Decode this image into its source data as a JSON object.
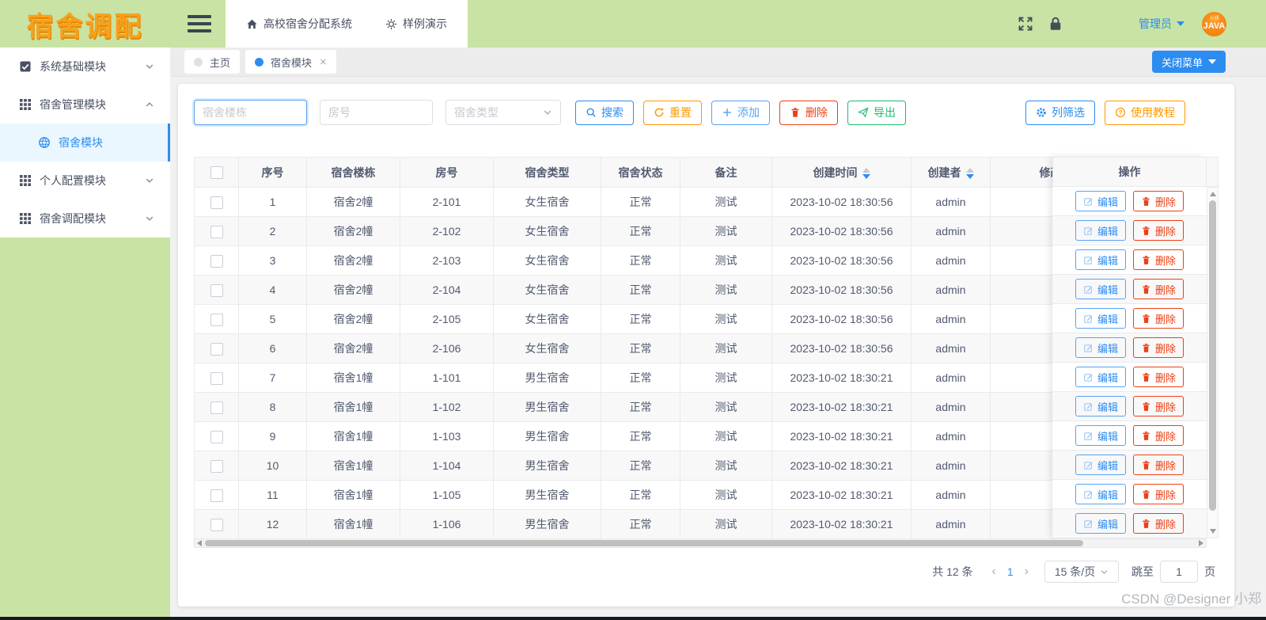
{
  "logo": "宿舍调配",
  "header": {
    "nav_system_title": "高校宿舍分配系统",
    "nav_demo": "样例演示",
    "user_name": "管理员",
    "avatar_top_text": "小郑",
    "avatar_text": "JAVA"
  },
  "sidebar": {
    "items": [
      {
        "label": "系统基础模块",
        "state": "collapsed"
      },
      {
        "label": "宿舍管理模块",
        "state": "expanded"
      },
      {
        "label": "个人配置模块",
        "state": "collapsed"
      },
      {
        "label": "宿舍调配模块",
        "state": "collapsed"
      }
    ],
    "active_subitem": "宿舍模块"
  },
  "tabs": [
    {
      "label": "主页",
      "active": false,
      "closable": false
    },
    {
      "label": "宿舍模块",
      "active": true,
      "closable": true
    }
  ],
  "tabbar": {
    "close_menu_label": "关闭菜单"
  },
  "filters": {
    "building_placeholder": "宿舍楼栋",
    "room_placeholder": "房号",
    "type_placeholder": "宿舍类型"
  },
  "toolbar": {
    "search": "搜索",
    "reset": "重置",
    "add": "添加",
    "delete": "删除",
    "export": "导出",
    "column_filter": "列筛选",
    "tutorial": "使用教程"
  },
  "table": {
    "headers": [
      "序号",
      "宿舍楼栋",
      "房号",
      "宿舍类型",
      "宿舍状态",
      "备注",
      "创建时间",
      "创建者",
      "修改时间",
      "操作"
    ],
    "sorted_columns": [
      "创建时间",
      "创建者"
    ],
    "edit_label": "编辑",
    "delete_label": "删除",
    "rows": [
      {
        "no": "1",
        "building": "宿舍2幢",
        "room": "2-101",
        "type": "女生宿舍",
        "status": "正常",
        "note": "测试",
        "created": "2023-10-02 18:30:56",
        "creator": "admin",
        "modified": ""
      },
      {
        "no": "2",
        "building": "宿舍2幢",
        "room": "2-102",
        "type": "女生宿舍",
        "status": "正常",
        "note": "测试",
        "created": "2023-10-02 18:30:56",
        "creator": "admin",
        "modified": ""
      },
      {
        "no": "3",
        "building": "宿舍2幢",
        "room": "2-103",
        "type": "女生宿舍",
        "status": "正常",
        "note": "测试",
        "created": "2023-10-02 18:30:56",
        "creator": "admin",
        "modified": ""
      },
      {
        "no": "4",
        "building": "宿舍2幢",
        "room": "2-104",
        "type": "女生宿舍",
        "status": "正常",
        "note": "测试",
        "created": "2023-10-02 18:30:56",
        "creator": "admin",
        "modified": ""
      },
      {
        "no": "5",
        "building": "宿舍2幢",
        "room": "2-105",
        "type": "女生宿舍",
        "status": "正常",
        "note": "测试",
        "created": "2023-10-02 18:30:56",
        "creator": "admin",
        "modified": ""
      },
      {
        "no": "6",
        "building": "宿舍2幢",
        "room": "2-106",
        "type": "女生宿舍",
        "status": "正常",
        "note": "测试",
        "created": "2023-10-02 18:30:56",
        "creator": "admin",
        "modified": ""
      },
      {
        "no": "7",
        "building": "宿舍1幢",
        "room": "1-101",
        "type": "男生宿舍",
        "status": "正常",
        "note": "测试",
        "created": "2023-10-02 18:30:21",
        "creator": "admin",
        "modified": ""
      },
      {
        "no": "8",
        "building": "宿舍1幢",
        "room": "1-102",
        "type": "男生宿舍",
        "status": "正常",
        "note": "测试",
        "created": "2023-10-02 18:30:21",
        "creator": "admin",
        "modified": ""
      },
      {
        "no": "9",
        "building": "宿舍1幢",
        "room": "1-103",
        "type": "男生宿舍",
        "status": "正常",
        "note": "测试",
        "created": "2023-10-02 18:30:21",
        "creator": "admin",
        "modified": ""
      },
      {
        "no": "10",
        "building": "宿舍1幢",
        "room": "1-104",
        "type": "男生宿舍",
        "status": "正常",
        "note": "测试",
        "created": "2023-10-02 18:30:21",
        "creator": "admin",
        "modified": ""
      },
      {
        "no": "11",
        "building": "宿舍1幢",
        "room": "1-105",
        "type": "男生宿舍",
        "status": "正常",
        "note": "测试",
        "created": "2023-10-02 18:30:21",
        "creator": "admin",
        "modified": ""
      },
      {
        "no": "12",
        "building": "宿舍1幢",
        "room": "1-106",
        "type": "男生宿舍",
        "status": "正常",
        "note": "测试",
        "created": "2023-10-02 18:30:21",
        "creator": "admin",
        "modified": ""
      }
    ]
  },
  "pagination": {
    "total": "共 12 条",
    "current_page": "1",
    "page_size": "15 条/页",
    "jump_label": "跳至",
    "jump_value": "1",
    "page_suffix": "页"
  },
  "watermark": "CSDN @Designer 小郑",
  "icons": {
    "hamburger": "three-bars",
    "home": "house",
    "demo": "aperture-sun",
    "fullscreen": "expand-arrows",
    "lock": "padlock",
    "search": "magnifier",
    "reset": "refresh-arrow",
    "add": "plus",
    "delete": "trash",
    "export": "paper-plane",
    "column_filter": "gear",
    "tutorial": "question-circle",
    "edit": "pen-square",
    "menu_module": "grid-dots",
    "menu_system": "checked-box",
    "active_submenu": "globe",
    "sort": "caret-up-down"
  },
  "colors": {
    "brand_green": "#c8e3a3",
    "logo_orange": "#f9a01b",
    "primary_blue": "#2d8cf0",
    "light_blue": "#57a3f3",
    "warning_orange": "#ff9900",
    "danger_red": "#ed4014",
    "success_green": "#19be6b",
    "table_header_bg": "#f8f8f9",
    "zebra_row": "#f8f8f9",
    "border": "#e8eaec",
    "text": "#515a6e"
  }
}
